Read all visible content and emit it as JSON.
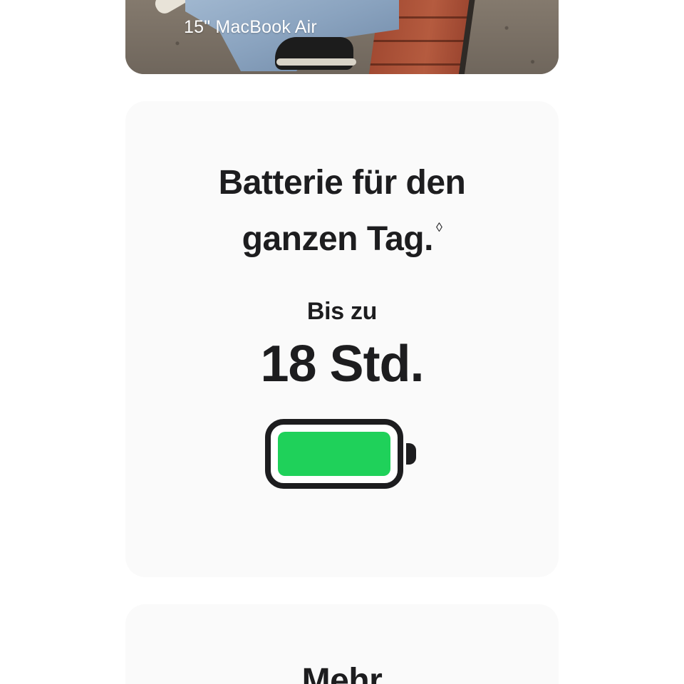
{
  "hero": {
    "caption": "15\" MacBook Air"
  },
  "battery_section": {
    "title_line1": "Batterie für den",
    "title_line2": "ganzen Tag.",
    "footnote_mark": "◊",
    "upto_label": "Bis zu",
    "hours_value": "18 Std.",
    "battery_charge_level": 1.0,
    "battery_fill_color": "#1fd15a",
    "battery_outline_color": "#1d1d1f",
    "icon": "battery-full-icon"
  },
  "next_section": {
    "title": "Mehr"
  },
  "colors": {
    "page_background": "#ffffff",
    "card_background": "#fafafa",
    "text": "#1d1d1f"
  }
}
